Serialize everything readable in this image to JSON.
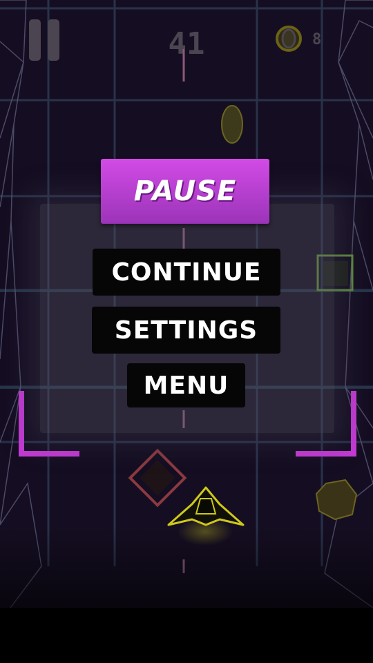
{
  "hud": {
    "score": "41",
    "coins": "8"
  },
  "pause_menu": {
    "title": "PAUSE",
    "continue_label": "CONTINUE",
    "settings_label": "SETTINGS",
    "menu_label": "MENU"
  },
  "colors": {
    "background": "#150e22",
    "grid": "#2f3550",
    "neon_magenta": "#c53ad6",
    "neon_yellow": "#d8d21a",
    "title_button": "#c444dc",
    "menu_button": "#060606"
  },
  "icons": {
    "pause": "pause-icon",
    "coin": "coin-icon"
  }
}
